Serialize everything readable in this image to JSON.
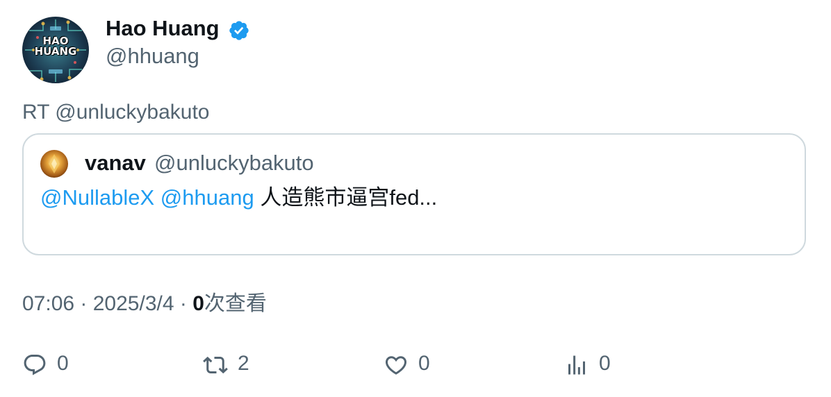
{
  "author": {
    "display_name": "Hao Huang",
    "handle": "@hhuang",
    "avatar_text_line1": "HAO",
    "avatar_text_line2": "HUANG",
    "verified": true
  },
  "tweet": {
    "text": "RT @unluckybakuto"
  },
  "quoted_tweet": {
    "display_name": "vanav",
    "handle": "@unluckybakuto",
    "mention_1": "@NullableX",
    "mention_2": "@hhuang",
    "text": "人造熊市逼宫fed..."
  },
  "meta": {
    "time": "07:06",
    "separator": " · ",
    "date": "2025/3/4",
    "views_count": "0",
    "views_label": "次查看"
  },
  "actions": {
    "replies": "0",
    "retweets": "2",
    "likes": "0",
    "views": "0"
  },
  "colors": {
    "accent": "#1d9bf0",
    "secondary_text": "#536471",
    "primary_text": "#0f1419",
    "border": "#cfd9de"
  }
}
